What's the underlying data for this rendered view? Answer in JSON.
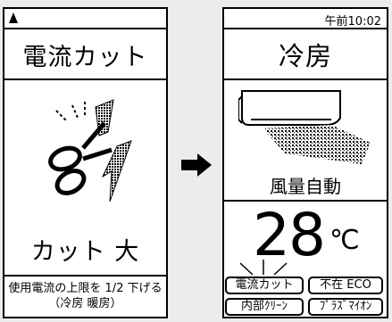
{
  "left_panel": {
    "title": "電流カット",
    "level_text": "カット 大",
    "note_line1": "使用電流の上限を 1/2 下げる",
    "note_line2": "（冷房 暖房）"
  },
  "right_panel": {
    "time": "午前10:02",
    "mode": "冷房",
    "fan": "風量自動",
    "temperature": "28",
    "unit": "℃",
    "tags": {
      "current_cut": "電流カット",
      "eco": "不在 ECO",
      "clean": "内部ｸﾘｰﾝ",
      "plasma": "ﾌﾟﾗｽﾞﾏｲｵﾝ"
    }
  },
  "icons": {
    "corner_marker": "triangle-marker-icon",
    "scissors": "scissors-icon",
    "arrow": "right-arrow-icon",
    "air_conditioner": "air-conditioner-icon",
    "indicator": "indicator-rays-icon"
  }
}
